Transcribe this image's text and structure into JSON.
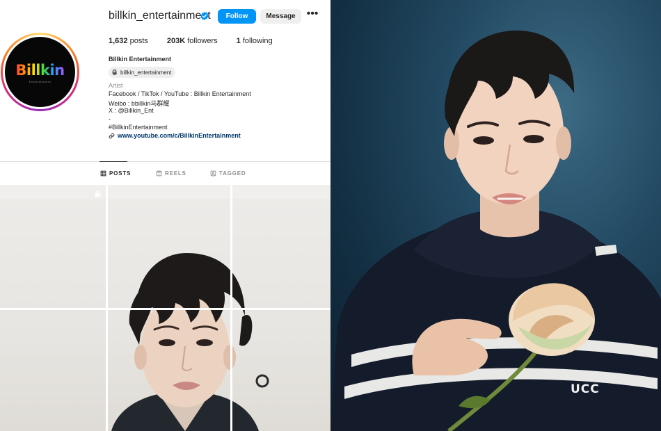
{
  "profile": {
    "username": "billkin_entertainment",
    "avatar_logo": "Billkin",
    "avatar_subtext": "Entertainment",
    "buttons": {
      "follow": "Follow",
      "message": "Message",
      "more": "•••"
    },
    "stats": {
      "posts_count": "1,632",
      "posts_label": "posts",
      "followers_count": "203K",
      "followers_label": "followers",
      "following_count": "1",
      "following_label": "following"
    },
    "full_name": "Billkin Entertainment",
    "threads_handle": "billkin_entertainment",
    "category": "Artist",
    "bio": [
      "Facebook / TikTok / YouTube : Billkin Entertainment",
      "Weibo : bbillkin马群耀",
      "X : @Billkin_Ent",
      "-",
      "#BillkinEntertainment"
    ],
    "link": "www.youtube.com/c/BillkinEntertainment"
  },
  "tabs": [
    {
      "label": "POSTS",
      "icon": "grid-icon",
      "active": true
    },
    {
      "label": "REELS",
      "icon": "reels-icon",
      "active": false
    },
    {
      "label": "TAGGED",
      "icon": "tagged-icon",
      "active": false
    }
  ],
  "colors": {
    "follow_button": "#0095f6",
    "link": "#00376b",
    "text_secondary": "#8e8e8e",
    "photo_background": "#1e4560"
  }
}
